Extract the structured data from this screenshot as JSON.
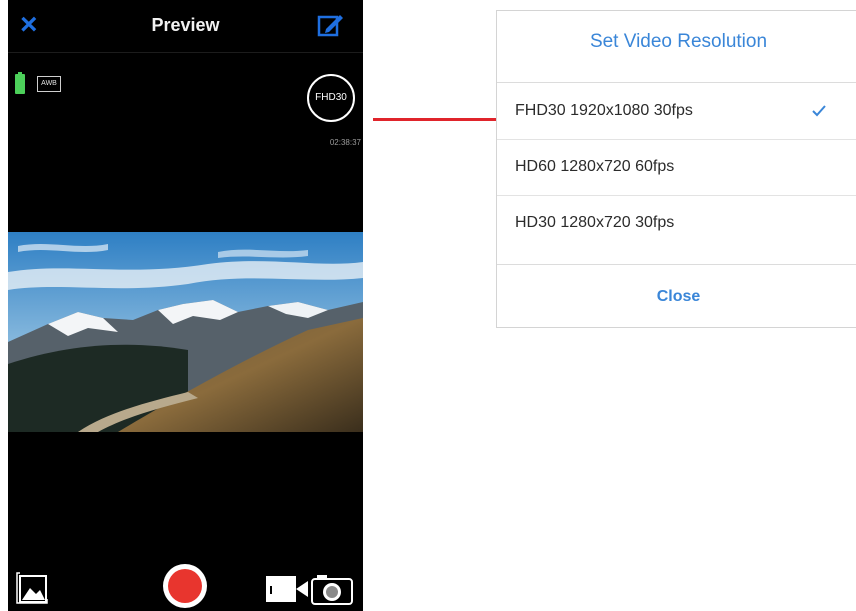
{
  "app": {
    "nav_title": "Preview",
    "awb_label": "AWB",
    "resolution_badge": "FHD30",
    "timer": "02:38:37"
  },
  "icons": {
    "close": "close-icon",
    "edit": "edit-icon",
    "battery": "battery-icon",
    "gallery": "gallery-icon",
    "record": "record-icon",
    "video_mode": "video-camera-icon",
    "photo_mode": "photo-camera-icon",
    "check": "checkmark-icon"
  },
  "dialog": {
    "title": "Set Video Resolution",
    "options": [
      {
        "label": "FHD30 1920x1080 30fps",
        "selected": true
      },
      {
        "label": "HD60 1280x720 60fps",
        "selected": false
      },
      {
        "label": "HD30 1280x720 30fps",
        "selected": false
      }
    ],
    "close_label": "Close"
  },
  "colors": {
    "accent_blue": "#3a86d8",
    "nav_icon_blue": "#1f6fe0",
    "record_red": "#e8352e",
    "connector_red": "#e0242b",
    "battery_green": "#4cd05a"
  }
}
